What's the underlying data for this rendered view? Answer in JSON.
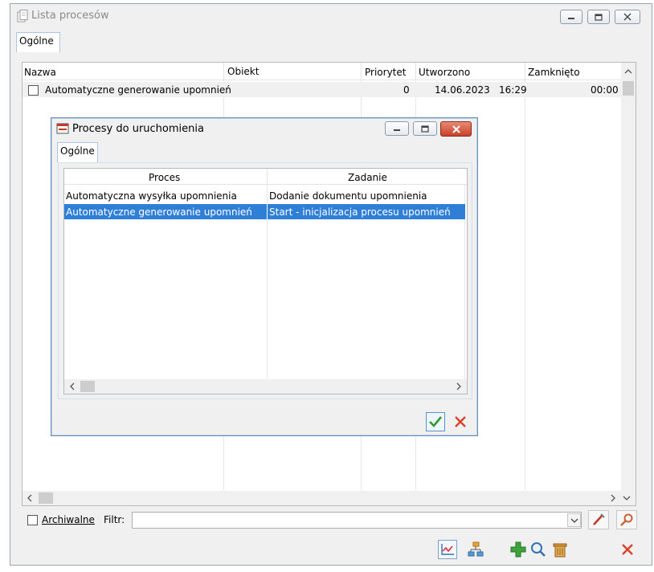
{
  "window": {
    "title": "Lista procesów",
    "tab": "Ogólne",
    "columns": [
      "Nazwa",
      "Obiekt",
      "Priorytet",
      "Utworzono",
      "Zamknięto"
    ],
    "row": {
      "name": "Automatyczne generowanie upomnień",
      "object": "",
      "priority": "0",
      "created_date": "14.06.2023",
      "created_time": "16:29",
      "closed": "00:00"
    },
    "archive_label": "Archiwalne",
    "filter_label": "Filtr:",
    "filter_value": ""
  },
  "dialog": {
    "title": "Procesy do uruchomienia",
    "tab": "Ogólne",
    "columns": [
      "Proces",
      "Zadanie"
    ],
    "rows": [
      {
        "proces": "Automatyczna wysyłka upomnienia",
        "zadanie": "Dodanie dokumentu upomnienia",
        "selected": false
      },
      {
        "proces": "Automatyczne generowanie upomnień",
        "zadanie": "Start - inicjalizacja procesu upomnień",
        "selected": true
      }
    ]
  },
  "colors": {
    "selection": "#2f7fd6",
    "close_red": "#d9412c",
    "ok_green": "#2f9a35",
    "tab_border": "#a9c4e6"
  }
}
